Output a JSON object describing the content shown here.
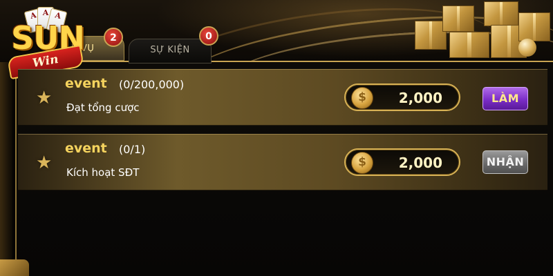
{
  "logo": {
    "word": "SUN",
    "script": "Win",
    "cards": [
      "A",
      "A",
      "A"
    ]
  },
  "tabs": [
    {
      "label": "VỤ",
      "badge": "2",
      "active": true
    },
    {
      "label": "SỰ KIỆN",
      "badge": "0",
      "active": false
    }
  ],
  "tasks": [
    {
      "title": "event",
      "progress": "(0/200,000)",
      "description": "Đạt tổng cược",
      "reward": "2,000",
      "action": "LÀM"
    },
    {
      "title": "event",
      "progress": "(0/1)",
      "description": "Kích hoạt SĐT",
      "reward": "2,000",
      "action": "NHẬN"
    }
  ],
  "icons": {
    "star": "★",
    "coin": "$"
  },
  "colors": {
    "gold": "#f5d35e",
    "panel_border": "#c9a452",
    "action_primary": "#7a2dc7",
    "action_disabled": "#6c6c6c",
    "badge": "#c0201a"
  }
}
